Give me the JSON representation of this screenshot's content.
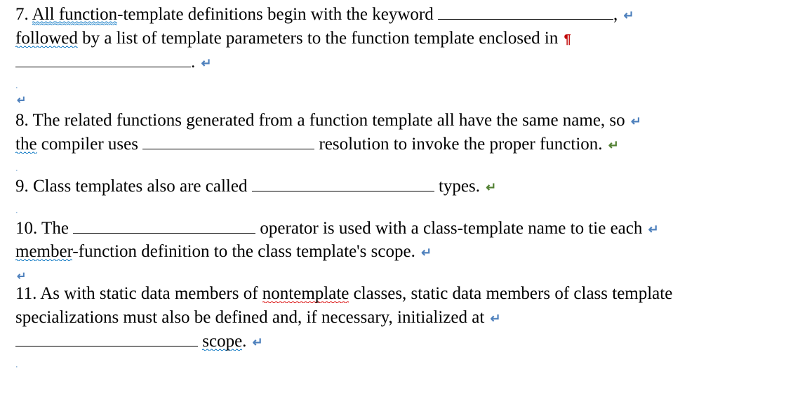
{
  "q7": {
    "num": "7.",
    "seg_all": "All",
    "seg_function": " function",
    "seg_a": "-template  definitions  begin  with   the  keyword  ",
    "seg_comma": ",",
    "seg_followed": "followed",
    "seg_b": "  by  a   list   of  template  parameters   to   the  function   template  enclosed   in",
    "seg_period": "."
  },
  "q8": {
    "num": "8.",
    "seg_a": " The related functions generated from a function template all have the same name, so",
    "seg_the": "the",
    "seg_b": " compiler uses ",
    "seg_c": " resolution to invoke the proper function."
  },
  "q9": {
    "num": "9.",
    "seg_a": " Class templates also are called ",
    "seg_b": " types."
  },
  "q10": {
    "num": "10.",
    "seg_a": "  The ",
    "seg_b": " operator is used with a class-template name to tie each",
    "seg_member": "member",
    "seg_c": "-function definition to the class template's scope."
  },
  "q11": {
    "num": "11.",
    "seg_a": "  As with static data members of ",
    "seg_nontemplate": "nontemplate",
    "seg_b": " classes, static data members of class template specializations must also be defined and, if necessary, initialized at",
    "seg_scope": "scope",
    "seg_period": "."
  },
  "marks": {
    "return": "↵",
    "paragraph": "¶",
    "tiny": "·"
  }
}
